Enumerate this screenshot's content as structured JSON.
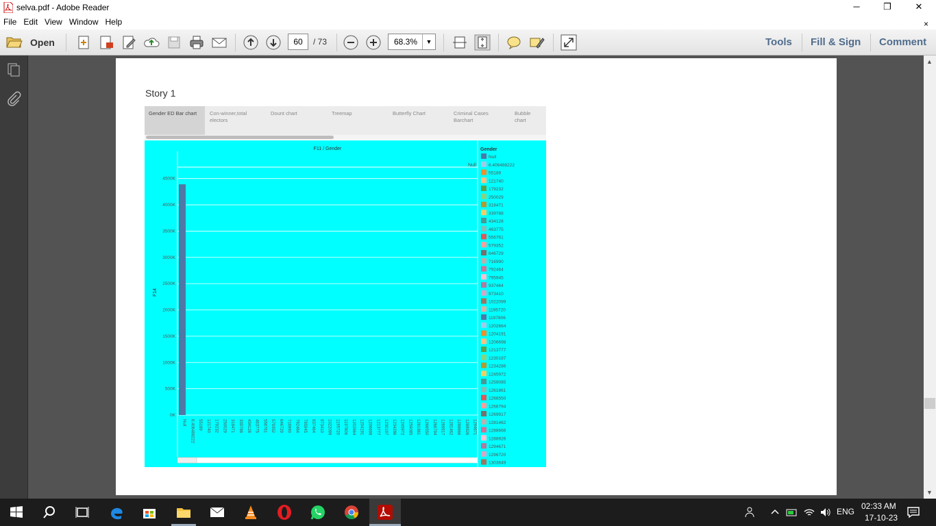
{
  "window": {
    "title": "selva.pdf - Adobe Reader"
  },
  "menu": {
    "items": [
      "File",
      "Edit",
      "View",
      "Window",
      "Help"
    ],
    "close": "×"
  },
  "toolbar": {
    "open_label": "Open",
    "current_page": "60",
    "total_pages": "/ 73",
    "zoom": "68.3%",
    "tools_label": "Tools",
    "fill_sign_label": "Fill & Sign",
    "comment_label": "Comment"
  },
  "document": {
    "story_title": "Story 1",
    "story_tabs": [
      "Gender ED Bar chart",
      "Con-winner,total electors",
      "Dount chart",
      "Treemap",
      "Butterfly Chart",
      "Criminal Cases Barchart",
      "Bubble chart"
    ]
  },
  "chart_data": {
    "type": "bar",
    "title": "F11 / Gender",
    "ylabel": "F14",
    "background": "#00ffff",
    "ylim": [
      0,
      4600
    ],
    "yticks": [
      "0K",
      "500K",
      "1000K",
      "1500K",
      "2000K",
      "2500K",
      "3000K",
      "3500K",
      "4000K",
      "4500K"
    ],
    "header_label": "Null",
    "legend_title": "Gender",
    "categories": [
      "Null",
      "6.406488222",
      "55189",
      "121740",
      "179232",
      "250029",
      "318471",
      "339788",
      "434128",
      "463775",
      "556761",
      "579352",
      "646729",
      "716990",
      "792464",
      "795945",
      "937464",
      "973410",
      "1022099",
      "1195720",
      "1197806",
      "1202664",
      "1204191",
      "1206698",
      "1213777",
      "1230197",
      "1234286",
      "1245972",
      "1259085",
      "1261861",
      "1266550",
      "1266794",
      "1269917",
      "1281462",
      "1288666",
      "1288926",
      "1294671"
    ],
    "values": [
      4390,
      0,
      0,
      0,
      0,
      0,
      0,
      0,
      0,
      0,
      0,
      0,
      0,
      0,
      0,
      0,
      0,
      0,
      0,
      0,
      0,
      0,
      0,
      0,
      0,
      0,
      0,
      0,
      0,
      0,
      0,
      0,
      0,
      0,
      0,
      0,
      0
    ],
    "value_unit": "K",
    "bar_color": "#4e79a7",
    "legend": [
      {
        "label": "Null",
        "color": "#4e79a7"
      },
      {
        "label": "6.406488222",
        "color": "#a0cbe8"
      },
      {
        "label": "55189",
        "color": "#f28e2b"
      },
      {
        "label": "121740",
        "color": "#ffbe7d"
      },
      {
        "label": "179232",
        "color": "#59a14f"
      },
      {
        "label": "250029",
        "color": "#8cd17d"
      },
      {
        "label": "318471",
        "color": "#b6992d"
      },
      {
        "label": "339788",
        "color": "#f1ce63"
      },
      {
        "label": "434128",
        "color": "#499894"
      },
      {
        "label": "463775",
        "color": "#86bcb6"
      },
      {
        "label": "556761",
        "color": "#e15759"
      },
      {
        "label": "579352",
        "color": "#ff9d9a"
      },
      {
        "label": "646729",
        "color": "#79706e"
      },
      {
        "label": "716990",
        "color": "#bab0ac"
      },
      {
        "label": "792464",
        "color": "#d37295"
      },
      {
        "label": "795945",
        "color": "#fabfd2"
      },
      {
        "label": "937464",
        "color": "#b07aa1"
      },
      {
        "label": "973410",
        "color": "#d4a6c8"
      },
      {
        "label": "1022099",
        "color": "#9d7660"
      },
      {
        "label": "1195720",
        "color": "#d7b5a6"
      },
      {
        "label": "1197806",
        "color": "#4e79a7"
      },
      {
        "label": "1202664",
        "color": "#a0cbe8"
      },
      {
        "label": "1204191",
        "color": "#f28e2b"
      },
      {
        "label": "1206698",
        "color": "#ffbe7d"
      },
      {
        "label": "1213777",
        "color": "#59a14f"
      },
      {
        "label": "1230197",
        "color": "#8cd17d"
      },
      {
        "label": "1234286",
        "color": "#b6992d"
      },
      {
        "label": "1245972",
        "color": "#f1ce63"
      },
      {
        "label": "1259085",
        "color": "#499894"
      },
      {
        "label": "1261861",
        "color": "#86bcb6"
      },
      {
        "label": "1266550",
        "color": "#e15759"
      },
      {
        "label": "1266794",
        "color": "#ff9d9a"
      },
      {
        "label": "1269917",
        "color": "#79706e"
      },
      {
        "label": "1281462",
        "color": "#bab0ac"
      },
      {
        "label": "1288666",
        "color": "#d37295"
      },
      {
        "label": "1288926",
        "color": "#fabfd2"
      },
      {
        "label": "1294671",
        "color": "#b07aa1"
      },
      {
        "label": "1296720",
        "color": "#d4a6c8"
      },
      {
        "label": "1303649",
        "color": "#9d7660"
      }
    ]
  },
  "taskbar": {
    "language": "ENG",
    "time": "02:33 AM",
    "date": "17-10-23"
  }
}
